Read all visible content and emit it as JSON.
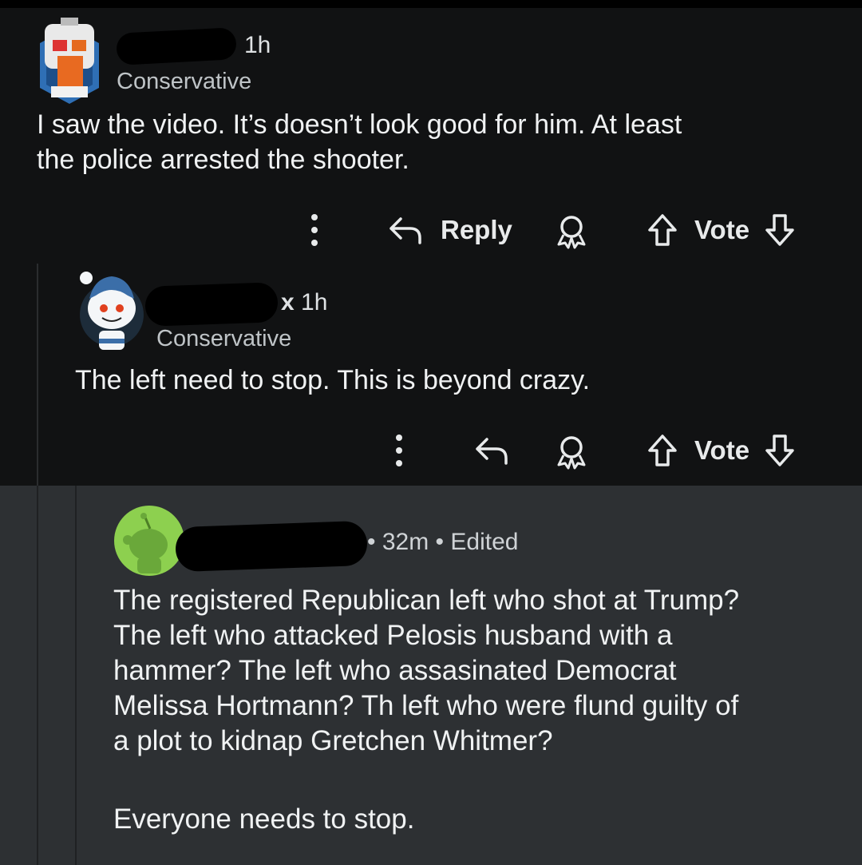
{
  "comments": [
    {
      "time": "1h",
      "community": "Conservative",
      "text_lines": [
        "I saw the video. It’s doesn’t look good for him. At least",
        "the police arrested the shooter."
      ],
      "actions": {
        "reply_label": "Reply",
        "vote_label": "Vote"
      }
    },
    {
      "name_suffix": "x",
      "time": "1h",
      "community": "Conservative",
      "text_lines": [
        "The left need to stop. This is beyond crazy."
      ],
      "actions": {
        "vote_label": "Vote"
      }
    },
    {
      "meta": "• 32m • Edited",
      "text_lines": [
        "The registered Republican left who shot at Trump?",
        "The left who attacked Pelosis husband with a",
        "hammer? The left who assasinated Democrat",
        "Melissa Hortmann? Th left who were flund guilty of",
        "a plot to kidnap Gretchen Whitmer?"
      ],
      "last_line": "Everyone needs to stop."
    }
  ],
  "colors": {
    "background": "#111213",
    "highlight": "#2d3033",
    "text": "#e8eaeb",
    "avatar_green": "#8dd04f"
  }
}
